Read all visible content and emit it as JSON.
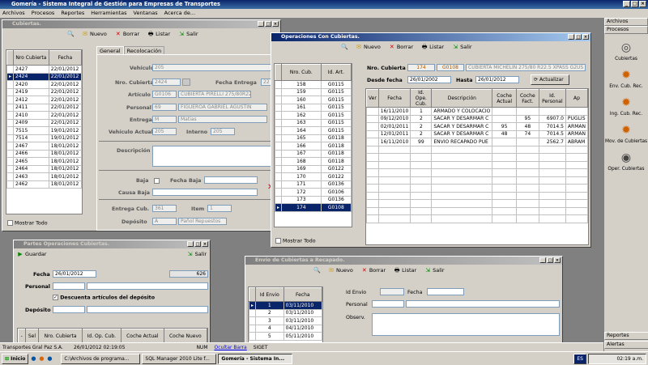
{
  "app": {
    "title": "Gomería - Sistema Integral de Gestión para Empresas de Transportes"
  },
  "menu": [
    "Archivos",
    "Procesos",
    "Reportes",
    "Herramientas",
    "Ventanas",
    "Acerca de..."
  ],
  "cubiertas": {
    "title": "Cubiertas.",
    "toolbar": {
      "nuevo": "Nuevo",
      "borrar": "Borrar",
      "listar": "Listar",
      "salir": "Salir"
    },
    "grid_headers": [
      "Nro Cubierta",
      "Fecha"
    ],
    "rows": [
      [
        "2427",
        "22/01/2012"
      ],
      [
        "2424",
        "22/01/2012"
      ],
      [
        "2420",
        "22/01/2012"
      ],
      [
        "2419",
        "22/01/2012"
      ],
      [
        "2412",
        "22/01/2012"
      ],
      [
        "2411",
        "22/01/2012"
      ],
      [
        "2410",
        "22/01/2012"
      ],
      [
        "2409",
        "22/01/2012"
      ],
      [
        "7515",
        "19/01/2012"
      ],
      [
        "7514",
        "19/01/2012"
      ],
      [
        "2467",
        "18/01/2012"
      ],
      [
        "2466",
        "18/01/2012"
      ],
      [
        "2465",
        "18/01/2012"
      ],
      [
        "2464",
        "18/01/2012"
      ],
      [
        "2463",
        "18/01/2012"
      ],
      [
        "2462",
        "18/01/2012"
      ]
    ],
    "mostrar_todo": "Mostrar Todo",
    "tabs": [
      "General",
      "Recolocación"
    ],
    "form": {
      "vehiculo_label": "Vehículo",
      "vehiculo": "205",
      "nro_cubierta_label": "Nro. Cubierta",
      "nro_cubierta": "2424",
      "fecha_entrega_label": "Fecha Entrega",
      "fecha_entrega": "22",
      "articulo_label": "Artículo",
      "articulo_code": "G0106",
      "articulo_desc": "CUBIERTA PIRELLI 275/80R225 mc 95",
      "personal_label": "Personal",
      "personal_code": "69",
      "personal_name": "FIGUEROA GABRIEL AGUSTIN",
      "entrega_label": "Entrega",
      "entrega_code": "M",
      "entrega_name": "Matias",
      "vehiculo_actual_label": "Vehículo Actual",
      "vehiculo_actual": "205",
      "interno_label": "Interno",
      "interno": "205",
      "descripcion_label": "Descripción",
      "baja_label": "Baja",
      "fecha_baja_label": "Fecha Baja",
      "causa_baja_label": "Causa Baja",
      "entrega_cub_label": "Entrega Cub.",
      "entrega_cub": "361",
      "item_label": "Item",
      "item": "1",
      "deposito_label": "Depósito",
      "deposito_code": "A",
      "deposito_name": "Pañol Repuestos"
    }
  },
  "operaciones": {
    "title": "Operaciones Con Cubiertas.",
    "toolbar": {
      "nuevo": "Nuevo",
      "borrar": "Borrar",
      "listar": "Listar",
      "salir": "Salir"
    },
    "left_headers": [
      "Nro. Cub.",
      "Id. Art."
    ],
    "left_rows": [
      [
        "158",
        "G0115"
      ],
      [
        "159",
        "G0115"
      ],
      [
        "160",
        "G0115"
      ],
      [
        "161",
        "G0115"
      ],
      [
        "162",
        "G0115"
      ],
      [
        "163",
        "G0115"
      ],
      [
        "164",
        "G0115"
      ],
      [
        "165",
        "G0118"
      ],
      [
        "166",
        "G0118"
      ],
      [
        "167",
        "G0118"
      ],
      [
        "168",
        "G0118"
      ],
      [
        "169",
        "G0122"
      ],
      [
        "170",
        "G0122"
      ],
      [
        "171",
        "G0136"
      ],
      [
        "172",
        "G0106"
      ],
      [
        "173",
        "G0136"
      ],
      [
        "174",
        "G0108"
      ]
    ],
    "mostrar_todo": "Mostrar Todo",
    "nro_cubierta_label": "Nro. Cubierta",
    "nro_cubierta": "174",
    "art_code": "G0108",
    "art_desc": "CUBIERTA MICHELIN 275/80 R22.5 XPASS G2US",
    "desde_label": "Desde fecha",
    "desde": "26/01/2002",
    "hasta_label": "Hasta",
    "hasta": "26/01/2012",
    "actualizar": "Actualizar",
    "headers": [
      "Ver",
      "Fecha",
      "Id. Ope. Cub.",
      "Descripción",
      "Coche Actual",
      "Coche Fact.",
      "Id. Personal",
      "Ap"
    ],
    "rows": [
      [
        "",
        "16/11/2010",
        "1",
        "ARMADO Y COLOCACIO",
        "",
        "",
        "",
        ""
      ],
      [
        "",
        "09/12/2010",
        "2",
        "SACAR Y DESARMAR C",
        "",
        "95",
        "6907.0",
        "PUGLIS"
      ],
      [
        "",
        "02/01/2011",
        "2",
        "SACAR Y DESARMAR C",
        "95",
        "48",
        "7014.5",
        "ARMAN"
      ],
      [
        "",
        "12/01/2011",
        "2",
        "SACAR Y DESARMAR C",
        "48",
        "74",
        "7014.5",
        "ARMAN"
      ],
      [
        "",
        "16/11/2010",
        "99",
        "ENVIO RECAPADO PUE",
        "",
        "",
        "2562.7",
        "ABRAM"
      ]
    ]
  },
  "partes": {
    "title": "Partes Operaciones Cubiertas.",
    "guardar": "Guardar",
    "salir": "Salir",
    "fecha_label": "Fecha",
    "fecha": "26/01/2012",
    "number": "626",
    "personal_label": "Personal",
    "descuenta": "Descuenta artículos del depósito",
    "deposito_label": "Depósito",
    "headers": [
      "-",
      "Sel",
      "Nro. Cubierta",
      "Id. Op. Cub.",
      "Coche Actual",
      "Coche Nuevo"
    ]
  },
  "envio": {
    "title": "Envío de Cubiertas a Recapado.",
    "toolbar": {
      "nuevo": "Nuevo",
      "borrar": "Borrar",
      "listar": "Listar",
      "salir": "Salir"
    },
    "headers": [
      "Id Envio",
      "Fecha"
    ],
    "rows": [
      [
        "1",
        "03/11/2010"
      ],
      [
        "2",
        "03/11/2010"
      ],
      [
        "3",
        "03/11/2010"
      ],
      [
        "4",
        "04/11/2010"
      ],
      [
        "5",
        "05/11/2010"
      ]
    ],
    "id_envio_label": "Id Envio",
    "fecha_label": "Fecha",
    "personal_label": "Personal",
    "observ_label": "Observ."
  },
  "side": {
    "archivos": "Archivos",
    "procesos": "Procesos",
    "reportes": "Reportes",
    "alertas": "Alertas",
    "items": [
      "Cubiertas",
      "Env. Cub. Rec.",
      "Ing. Cub. Rec.",
      "Mov. de Cubiertas",
      "Oper. Cubiertas"
    ]
  },
  "status": {
    "user": "Transportes Gral Paz S.A.",
    "datetime": "26/01/2012 02:19:05",
    "num": "NUM",
    "ocultar": "Ocultar Barra",
    "siget": "SIGET"
  },
  "taskbar": {
    "start": "Inicio",
    "items": [
      "C:\\Archivos de programa...",
      "SQL Manager 2010 Lite f...",
      "Gomería - Sistema In..."
    ],
    "lang": "ES",
    "time": "02:19 a.m."
  },
  "colors": {
    "title_active": "#0a246a",
    "selection": "#0a246a",
    "face": "#d4d0c8"
  }
}
